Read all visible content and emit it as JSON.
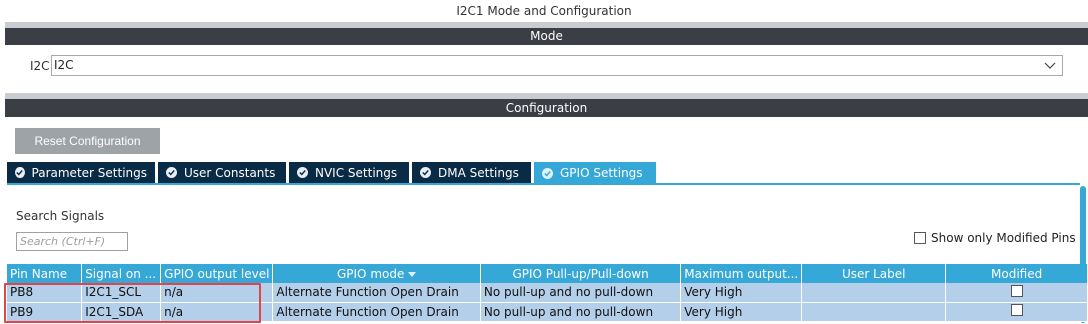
{
  "window": {
    "title": "I2C1 Mode and Configuration"
  },
  "mode": {
    "section_label": "Mode",
    "i2c_label": "I2C",
    "i2c_value": "I2C"
  },
  "configuration": {
    "section_label": "Configuration",
    "reset_label": "Reset Configuration",
    "tabs": [
      {
        "label": "Parameter Settings",
        "active": false
      },
      {
        "label": "User Constants",
        "active": false
      },
      {
        "label": "NVIC Settings",
        "active": false
      },
      {
        "label": "DMA Settings",
        "active": false
      },
      {
        "label": "GPIO Settings",
        "active": true
      }
    ]
  },
  "gpio": {
    "search_label": "Search Signals",
    "search_placeholder": "Search (Ctrl+F)",
    "modified_only_label": "Show only Modified Pins",
    "columns": [
      "Pin Name",
      "Signal on ...",
      "GPIO output level",
      "GPIO mode",
      "GPIO Pull-up/Pull-down",
      "Maximum output...",
      "User Label",
      "Modified"
    ],
    "rows": [
      {
        "pin": "PB8",
        "signal": "I2C1_SCL",
        "output_level": "n/a",
        "mode": "Alternate Function Open Drain",
        "pull": "No pull-up and no pull-down",
        "max_speed": "Very High",
        "user_label": "",
        "modified": false
      },
      {
        "pin": "PB9",
        "signal": "I2C1_SDA",
        "output_level": "n/a",
        "mode": "Alternate Function Open Drain",
        "pull": "No pull-up and no pull-down",
        "max_speed": "Very High",
        "user_label": "",
        "modified": false
      }
    ]
  },
  "colors": {
    "accent": "#35a8d8",
    "tab_inactive": "#0a2b45",
    "section_bar": "#3b3f45",
    "row_bg": "#b3cfe9",
    "highlight": "#e0454a"
  },
  "icons": [
    "chevron-down-icon",
    "check-circle-icon",
    "sort-down-icon",
    "checkbox-icon"
  ]
}
